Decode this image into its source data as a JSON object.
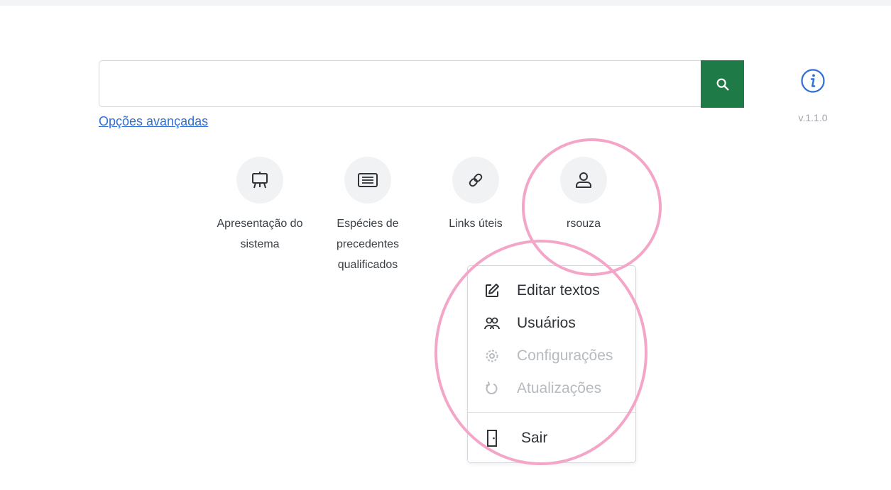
{
  "search": {
    "value": "",
    "placeholder": "",
    "advanced_link": "Opções avançadas"
  },
  "info": {
    "version": "v.1.1.0"
  },
  "tiles": [
    {
      "label": "Apresentação do sistema",
      "icon": "presentation-icon"
    },
    {
      "label": "Espécies de precedentes qualificados",
      "icon": "list-icon"
    },
    {
      "label": "Links úteis",
      "icon": "link-icon"
    },
    {
      "label": "rsouza",
      "icon": "user-icon"
    }
  ],
  "user_menu": {
    "items": [
      {
        "label": "Editar textos",
        "icon": "edit-icon",
        "enabled": true
      },
      {
        "label": "Usuários",
        "icon": "users-icon",
        "enabled": true
      },
      {
        "label": "Configurações",
        "icon": "gear-icon",
        "enabled": false
      },
      {
        "label": "Atualizações",
        "icon": "refresh-icon",
        "enabled": false
      },
      {
        "label": "Sair",
        "icon": "logout-icon",
        "enabled": true
      }
    ]
  },
  "colors": {
    "search_button": "#1e7a46",
    "link": "#2f6fd6",
    "info_icon": "#2f6fd6",
    "highlight": "#f3a6c8",
    "disabled_text": "#b7bbc0"
  }
}
